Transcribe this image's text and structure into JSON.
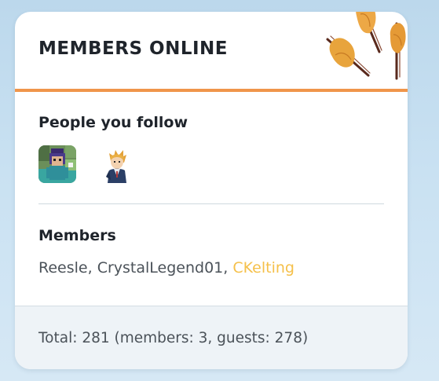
{
  "widget": {
    "title": "MEMBERS ONLINE",
    "accent_color": "#f0954a",
    "decoration_icon": "autumn-leaves"
  },
  "follow": {
    "heading": "People you follow",
    "avatars": [
      {
        "name": "followed-user-avatar-1",
        "style": "pixel-art-minecraft-skin"
      },
      {
        "name": "followed-user-avatar-2",
        "style": "anime-character-blond"
      }
    ]
  },
  "members": {
    "heading": "Members",
    "list": [
      {
        "name": "Reesle",
        "sep": ", "
      },
      {
        "name": "CrystalLegend01",
        "sep": ", "
      },
      {
        "name": "CKelting",
        "sep": ""
      }
    ],
    "highlight_color": "#f5c04a"
  },
  "footer": {
    "total_text": "Total: 281 (members: 3, guests: 278)"
  }
}
